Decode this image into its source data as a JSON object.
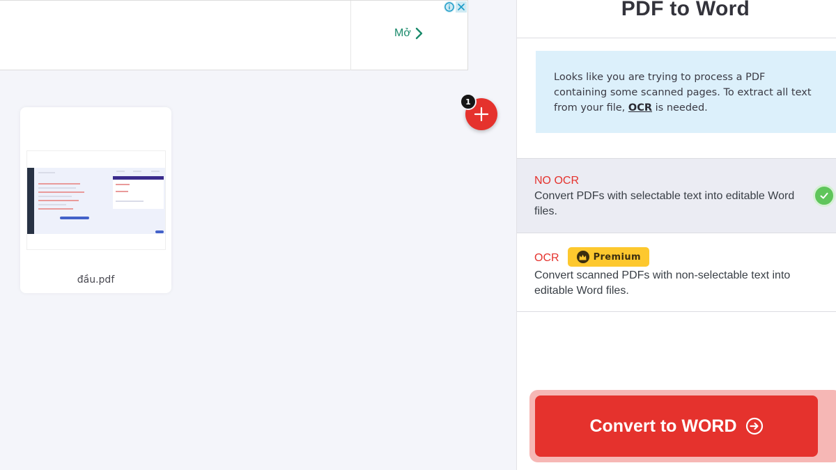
{
  "ad": {
    "open_label": "Mở",
    "info_icon": "info-icon",
    "close_icon": "close-icon"
  },
  "file": {
    "name": "đầu.pdf"
  },
  "files_count": "1",
  "sidebar": {
    "title": "PDF to Word",
    "notice": {
      "text_before": "Looks like you are trying to process a PDF containing some scanned pages. To extract all text from your file, ",
      "link": "OCR",
      "text_after": " is needed."
    },
    "options": {
      "no_ocr": {
        "title": "NO OCR",
        "description": "Convert PDFs with selectable text into editable Word files.",
        "selected": true
      },
      "ocr": {
        "title": "OCR",
        "badge": "Premium",
        "description": "Convert scanned PDFs with non-selectable text into editable Word files.",
        "selected": false
      }
    },
    "convert_label": "Convert to WORD"
  },
  "colors": {
    "accent_red": "#e5322d",
    "notice_bg": "#dcf0fb",
    "premium_yellow": "#fdc82e",
    "check_green": "#5fc55b",
    "ad_link_green": "#1a8a6b"
  }
}
